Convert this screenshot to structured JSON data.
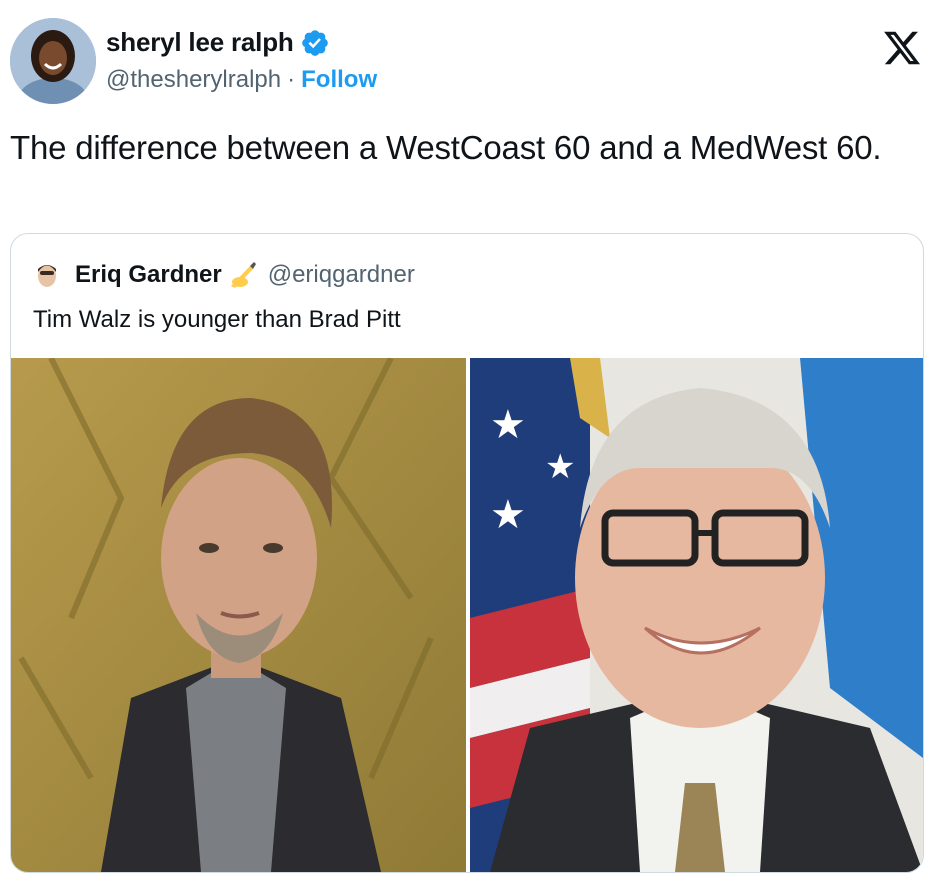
{
  "author": {
    "display_name": "sheryl lee ralph",
    "handle": "@thesherylralph",
    "separator": "·",
    "follow_label": "Follow",
    "verified": true
  },
  "tweet": {
    "text": "The difference between a WestCoast 60 and a MedWest 60."
  },
  "quoted_tweet": {
    "display_name": "Eriq Gardner",
    "emoji_icon": "writing-hand-icon",
    "handle": "@eriqgardner",
    "text": "Tim Walz is younger than Brad Pitt"
  },
  "colors": {
    "link_blue": "#1d9bf0",
    "secondary_text": "#536471",
    "border": "#cfd9de",
    "primary_text": "#0f1419"
  },
  "icons": {
    "brand": "x-logo-icon",
    "verified": "verified-badge-icon"
  }
}
